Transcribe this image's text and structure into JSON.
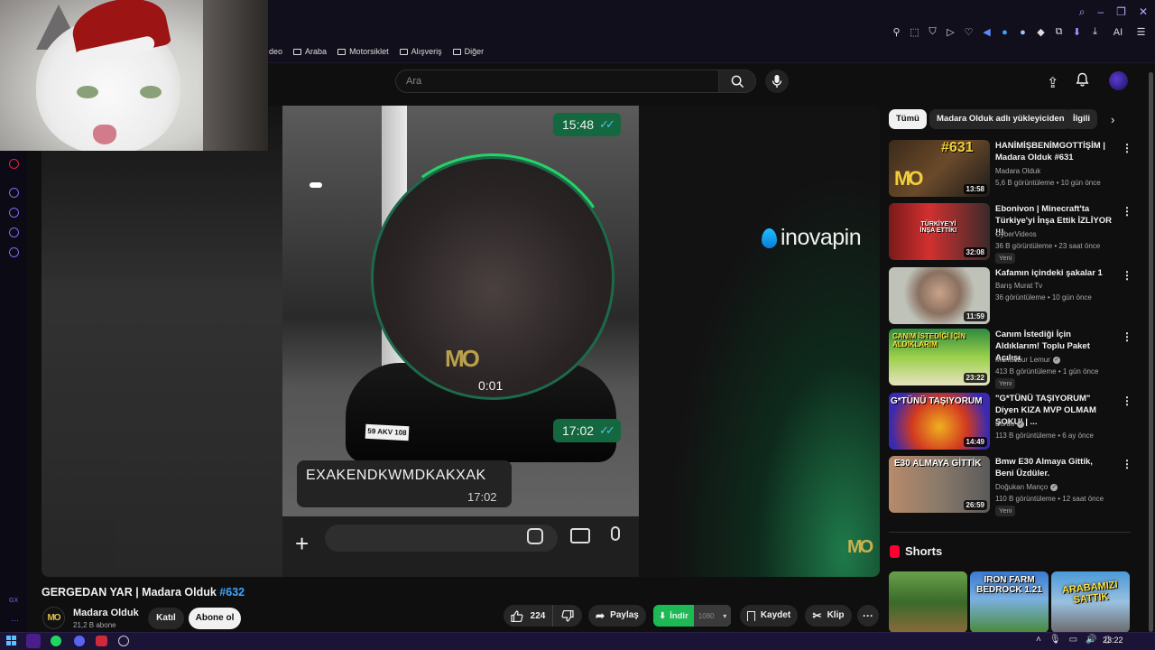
{
  "browser": {
    "bookmarks": [
      "Araba",
      "Motorsiklet",
      "Alışveriş",
      "Diğer"
    ],
    "bookmark_cut_label": "deo",
    "ai_label": "AI"
  },
  "header": {
    "search_placeholder": "Ara"
  },
  "player": {
    "top_time": "15:48",
    "bubble_time": "0:01",
    "bottom_time": "17:02",
    "message_text": "EXAKENDKWMDKAKXAK",
    "message_time": "17:02",
    "plate": "59 AKV 108",
    "sponsor": "inovapin",
    "watermark": "MO"
  },
  "video": {
    "title_main": "GERGEDAN YAR | Madara Olduk ",
    "title_tag": "#632",
    "channel_name": "Madara Olduk",
    "channel_subs": "21,2 B abone",
    "channel_avatar": "MO",
    "join_label": "Katıl",
    "subscribe_label": "Abone ol",
    "likes": "224",
    "share_label": "Paylaş",
    "download_label": "İndir",
    "download_quality": "1080",
    "save_label": "Kaydet",
    "clip_label": "Klip"
  },
  "chips": [
    "Tümü",
    "Madara Olduk adlı yükleyiciden",
    "İlgili"
  ],
  "recommendations": [
    {
      "title": "HANİMİŞBENİMGOTTİŞİM | Madara Olduk #631",
      "channel": "Madara Olduk",
      "meta": "5,6 B görüntüleme • 10 gün önce",
      "duration": "13:58",
      "thumb_text": "#631",
      "is_new": false,
      "verified": false
    },
    {
      "title": "Ebonivon | Minecraft'ta Türkiye'yi İnşa Ettik İZLİYOR !!!",
      "channel": "CyberVideos",
      "meta": "36 B görüntüleme • 23 saat önce",
      "duration": "32:08",
      "thumb_text": "TÜRKİYE'Yİ İNŞA ETTİK!",
      "is_new": true,
      "verified": false
    },
    {
      "title": "Kafamın içindeki şakalar 1",
      "channel": "Barış Murat Tv",
      "meta": "36 görüntüleme • 10 gün önce",
      "duration": "11:59",
      "thumb_text": "",
      "is_new": false,
      "verified": false
    },
    {
      "title": "Canım İstediği İçin Aldıklarım! Toplu Paket Açılışı",
      "channel": "Mendebur Lemur",
      "meta": "413 B görüntüleme • 1 gün önce",
      "duration": "23:22",
      "thumb_text": "CANIM İSTEDİĞİ İÇİN ALDIKLARIM",
      "is_new": true,
      "verified": true
    },
    {
      "title": "\"G*TÜNÜ TAŞIYORUM\" Diyen KIZA MVP OLMAM ŞOKU! | ...",
      "channel": "Bordo",
      "meta": "113 B görüntüleme • 6 ay önce",
      "duration": "14:49",
      "thumb_text": "G*TÜNÜ TAŞIYORUM",
      "is_new": false,
      "verified": true
    },
    {
      "title": "Bmw E30 Almaya Gittik, Beni Üzdüler.",
      "channel": "Doğukan Manço",
      "meta": "110 B görüntüleme • 12 saat önce",
      "duration": "26:59",
      "thumb_text": "E30 ALMAYA GİTTİK",
      "is_new": true,
      "verified": true
    }
  ],
  "new_badge": "Yeni",
  "shorts": {
    "label": "Shorts",
    "items": [
      "",
      "IRON FARM BEDROCK 1.21",
      "ARABAMIZI SATTIK"
    ]
  },
  "taskbar": {
    "clock": "23:22"
  },
  "colors": {
    "accent_blue": "#3ea6ff",
    "download_green": "#1db954",
    "whatsapp_green": "#14683f",
    "shorts_red": "#ff0033"
  }
}
